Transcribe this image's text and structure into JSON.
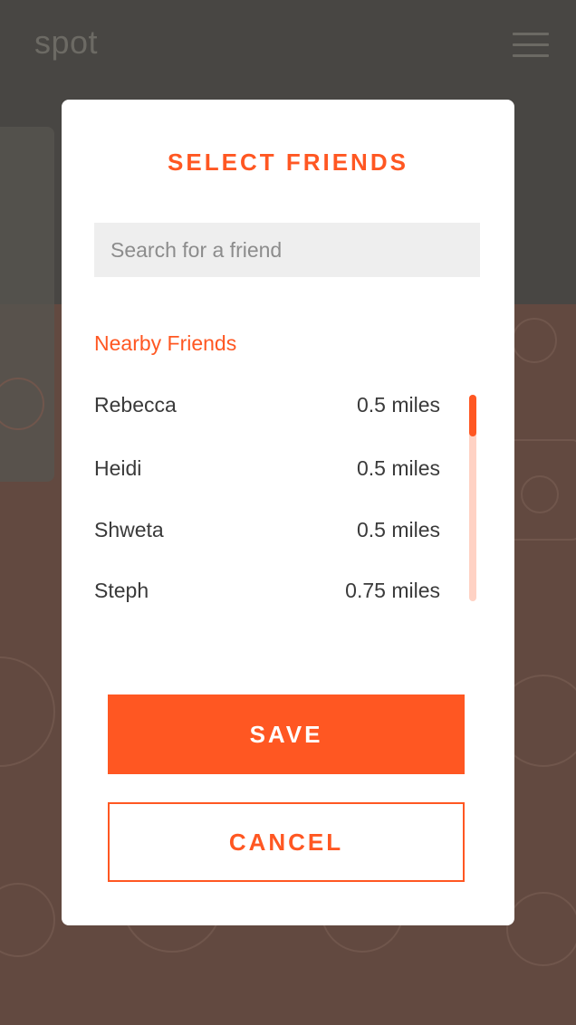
{
  "app": {
    "logo": "spot",
    "menu_icon": "hamburger-menu-icon"
  },
  "modal": {
    "title": "SELECT FRIENDS",
    "search": {
      "placeholder": "Search for a friend",
      "value": ""
    },
    "section_label": "Nearby Friends",
    "friends": [
      {
        "name": "Rebecca",
        "distance": "0.5 miles"
      },
      {
        "name": "Heidi",
        "distance": "0.5 miles"
      },
      {
        "name": "Shweta",
        "distance": "0.5 miles"
      },
      {
        "name": "Steph",
        "distance": "0.75 miles"
      }
    ],
    "save_label": "SAVE",
    "cancel_label": "CANCEL"
  },
  "colors": {
    "accent": "#ff5722",
    "header_bg": "#4f4d49",
    "page_bg": "#6b5046",
    "scroll_track": "#ffd2c4",
    "search_bg": "#eeeeee"
  }
}
